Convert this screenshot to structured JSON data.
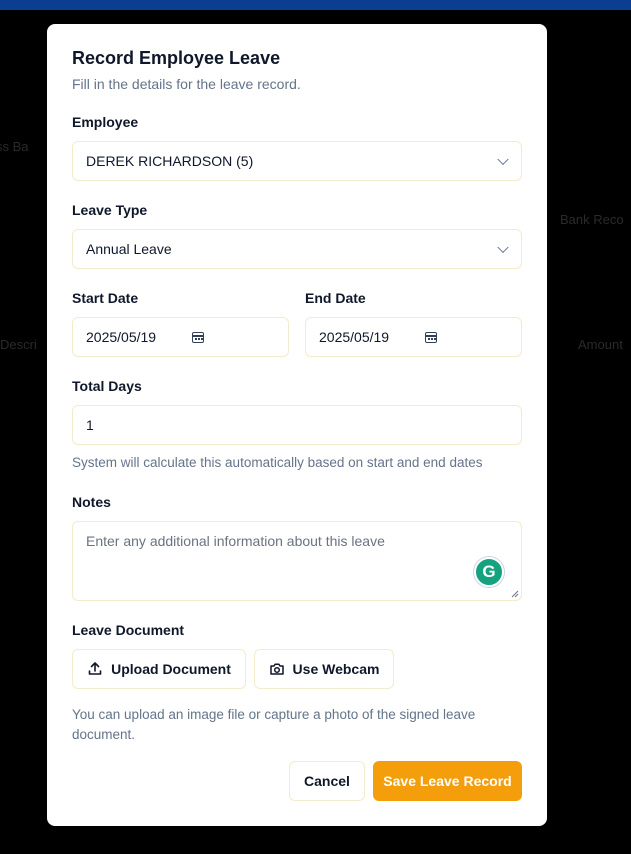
{
  "background": {
    "fragments": [
      "ss Ba",
      "Bank Reco",
      "Descri",
      "Amount"
    ]
  },
  "dialog": {
    "title": "Record Employee Leave",
    "subtitle": "Fill in the details for the leave record.",
    "employee": {
      "label": "Employee",
      "value": "DEREK RICHARDSON (5)"
    },
    "leave_type": {
      "label": "Leave Type",
      "value": "Annual Leave"
    },
    "start_date": {
      "label": "Start Date",
      "value": "2025/05/19"
    },
    "end_date": {
      "label": "End Date",
      "value": "2025/05/19"
    },
    "total_days": {
      "label": "Total Days",
      "value": "1",
      "help": "System will calculate this automatically based on start and end dates"
    },
    "notes": {
      "label": "Notes",
      "placeholder": "Enter any additional information about this leave"
    },
    "document": {
      "label": "Leave Document",
      "upload_label": "Upload Document",
      "webcam_label": "Use Webcam",
      "help": "You can upload an image file or capture a photo of the signed leave document."
    },
    "actions": {
      "cancel": "Cancel",
      "save": "Save Leave Record"
    }
  },
  "colors": {
    "accent": "#f59e0b",
    "topbar": "#0b3d91",
    "field_border": "#f3eccc"
  },
  "icons": [
    "chevron-down-icon",
    "calendar-icon",
    "upload-icon",
    "camera-icon",
    "grammarly-icon"
  ]
}
